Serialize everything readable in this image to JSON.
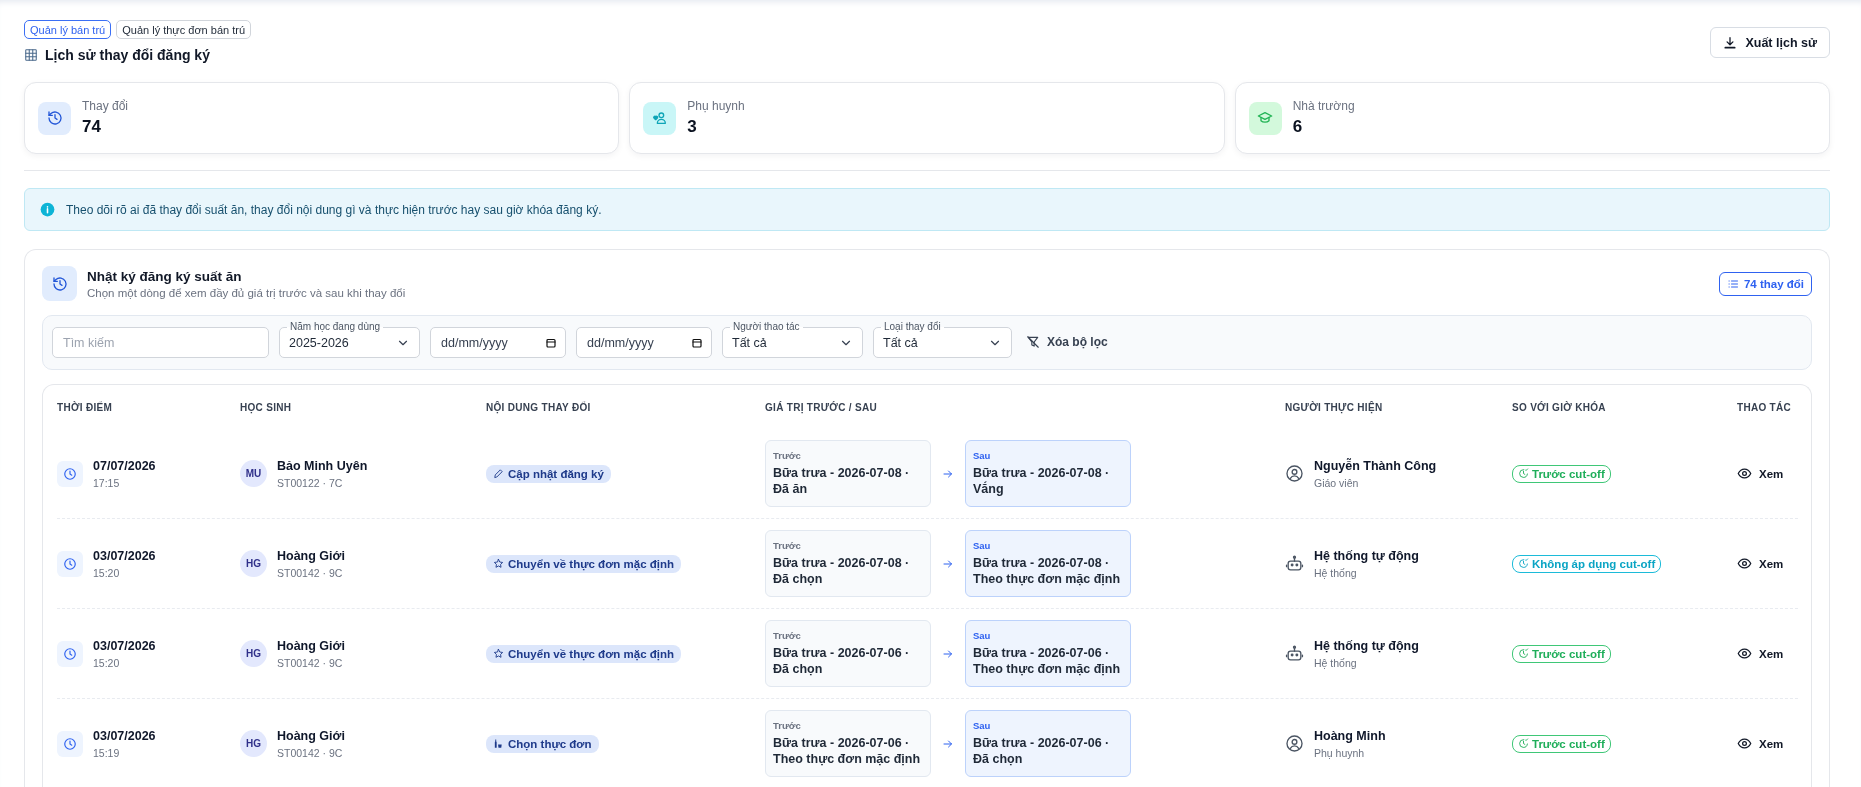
{
  "tabs": [
    {
      "label": "Quản lý bán trú",
      "selected": true
    },
    {
      "label": "Quản lý thực đơn bán trú",
      "selected": false
    }
  ],
  "page_title": "Lịch sử thay đổi đăng ký",
  "export_button": "Xuất lịch sử",
  "stats": [
    {
      "kind": "changes",
      "label": "Thay đổi",
      "value": "74"
    },
    {
      "kind": "parents",
      "label": "Phụ huynh",
      "value": "3"
    },
    {
      "kind": "school",
      "label": "Nhà trường",
      "value": "6"
    }
  ],
  "info_banner": "Theo dõi rõ ai đã thay đổi suất ăn, thay đổi nội dung gì và thực hiện trước hay sau giờ khóa đăng ký.",
  "log": {
    "title": "Nhật ký đăng ký suất ăn",
    "subtitle": "Chọn một dòng để xem đầy đủ giá trị trước và sau khi thay đổi",
    "count_button": "74 thay đổi",
    "filters": {
      "search": {
        "placeholder": "Tìm kiếm"
      },
      "school_year": {
        "label": "Năm học đang dùng",
        "value": "2025-2026"
      },
      "date_from": {
        "placeholder": "dd/mm/yyyy"
      },
      "date_to": {
        "placeholder": "dd/mm/yyyy"
      },
      "actor": {
        "label": "Người thao tác",
        "value": "Tất cả"
      },
      "change_type": {
        "label": "Loại thay đổi",
        "value": "Tất cả"
      },
      "clear_button": "Xóa bộ lọc"
    },
    "table": {
      "columns": [
        "THỜI ĐIỂM",
        "HỌC SINH",
        "NỘI DUNG THAY ĐỔI",
        "GIÁ TRỊ TRƯỚC / SAU",
        "NGƯỜI THỰC HIỆN",
        "SO VỚI GIỜ KHÓA",
        "THAO TÁC"
      ],
      "rows": [
        {
          "date": "07/07/2026",
          "time": "17:15",
          "initials": "MU",
          "student": "Bảo Minh Uyên",
          "student_code": "ST00122 · 7C",
          "change": {
            "kind": "edit",
            "label": "Cập nhật đăng ký"
          },
          "before_label": "Trước",
          "before": "Bữa trưa - 2026-07-08 · Đã ăn",
          "after_label": "Sau",
          "after": "Bữa trưa - 2026-07-08 · Vắng",
          "actor": {
            "kind": "person",
            "name": "Nguyễn Thành Công",
            "role": "Giáo viên"
          },
          "cutoff": {
            "kind": "before",
            "label": "Trước cut-off"
          },
          "action": "Xem"
        },
        {
          "date": "03/07/2026",
          "time": "15:20",
          "initials": "HG",
          "student": "Hoàng Giới",
          "student_code": "ST00142 · 9C",
          "change": {
            "kind": "default",
            "label": "Chuyển về thực đơn mặc định"
          },
          "before_label": "Trước",
          "before": "Bữa trưa - 2026-07-08 · Đã chọn",
          "after_label": "Sau",
          "after": "Bữa trưa - 2026-07-08 · Theo thực đơn mặc định",
          "actor": {
            "kind": "system",
            "name": "Hệ thống tự động",
            "role": "Hệ thống"
          },
          "cutoff": {
            "kind": "not_applicable",
            "label": "Không áp dụng cut-off"
          },
          "action": "Xem"
        },
        {
          "date": "03/07/2026",
          "time": "15:20",
          "initials": "HG",
          "student": "Hoàng Giới",
          "student_code": "ST00142 · 9C",
          "change": {
            "kind": "default",
            "label": "Chuyển về thực đơn mặc định"
          },
          "before_label": "Trước",
          "before": "Bữa trưa - 2026-07-06 · Đã chọn",
          "after_label": "Sau",
          "after": "Bữa trưa - 2026-07-06 · Theo thực đơn mặc định",
          "actor": {
            "kind": "system",
            "name": "Hệ thống tự động",
            "role": "Hệ thống"
          },
          "cutoff": {
            "kind": "before",
            "label": "Trước cut-off"
          },
          "action": "Xem"
        },
        {
          "date": "03/07/2026",
          "time": "15:19",
          "initials": "HG",
          "student": "Hoàng Giới",
          "student_code": "ST00142 · 9C",
          "change": {
            "kind": "menu",
            "label": "Chọn thực đơn"
          },
          "before_label": "Trước",
          "before": "Bữa trưa - 2026-07-06 · Theo thực đơn mặc định",
          "after_label": "Sau",
          "after": "Bữa trưa - 2026-07-06 · Đã chọn",
          "actor": {
            "kind": "person",
            "name": "Hoàng Minh",
            "role": "Phụ huynh"
          },
          "cutoff": {
            "kind": "before",
            "label": "Trước cut-off"
          },
          "action": "Xem"
        }
      ]
    }
  }
}
